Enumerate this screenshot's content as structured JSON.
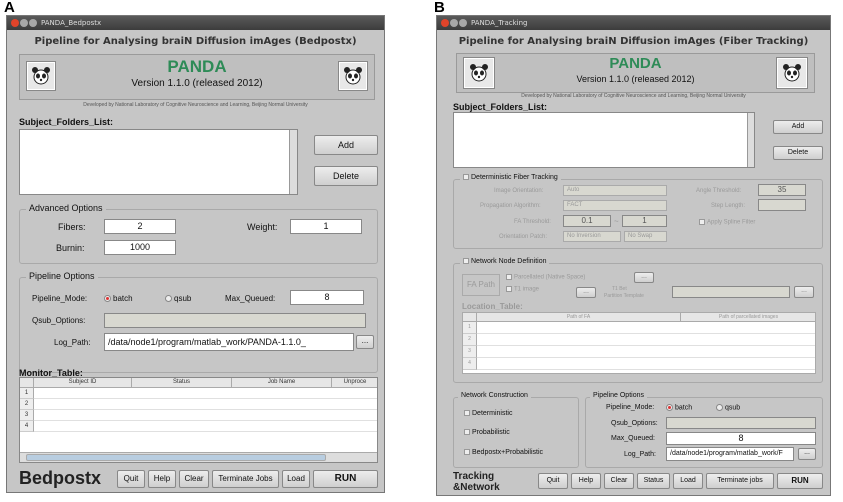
{
  "panels": {
    "a": "A",
    "b": "B"
  },
  "bedpostx": {
    "window_title": "PANDA_Bedpostx",
    "header": "Pipeline for Analysing braiN Diffusion imAges (Bedpostx)",
    "panda_name": "PANDA",
    "version": "Version 1.1.0 (released 2012)",
    "developed_by": "Developed by National Laboratory of Cognitive Neuroscience and Learning, Beijing Normal University",
    "subject_folders_label": "Subject_Folders_List:",
    "add_label": "Add",
    "delete_label": "Delete",
    "advanced_options": {
      "title": "Advanced Options",
      "fibers_label": "Fibers:",
      "fibers_value": "2",
      "weight_label": "Weight:",
      "weight_value": "1",
      "burnin_label": "Burnin:",
      "burnin_value": "1000"
    },
    "pipeline_options": {
      "title": "Pipeline Options",
      "mode_label": "Pipeline_Mode:",
      "batch_label": "batch",
      "qsub_label": "qsub",
      "max_queued_label": "Max_Queued:",
      "max_queued_value": "8",
      "qsub_options_label": "Qsub_Options:",
      "qsub_options_value": "",
      "log_path_label": "Log_Path:",
      "log_path_value": "/data/node1/program/matlab_work/PANDA-1.1.0_",
      "browse_label": "..."
    },
    "monitor_table": {
      "label": "Monitor_Table:",
      "columns": [
        "Subject ID",
        "Status",
        "Job Name",
        "Unproce"
      ],
      "rows": [
        "1",
        "2",
        "3",
        "4"
      ]
    },
    "footer_title": "Bedpostx",
    "buttons": {
      "quit": "Quit",
      "help": "Help",
      "clear": "Clear",
      "terminate": "Terminate Jobs",
      "load": "Load",
      "run": "RUN"
    }
  },
  "tracking": {
    "window_title": "PANDA_Tracking",
    "header": "Pipeline for Analysing braiN Diffusion imAges (Fiber Tracking)",
    "panda_name": "PANDA",
    "version": "Version 1.1.0 (released 2012)",
    "developed_by": "Developed by National Laboratory of Cognitive Neuroscience and Learning, Beijing Normal University",
    "subject_folders_label": "Subject_Folders_List:",
    "add_label": "Add",
    "delete_label": "Delete",
    "deterministic": {
      "title": "Deterministic Fiber Tracking",
      "image_orientation_label": "Image Orientation:",
      "image_orientation_value": "Auto",
      "angle_threshold_label": "Angle Threshold:",
      "angle_threshold_value": "35",
      "propagation_label": "Propagation Algorithm:",
      "propagation_value": "FACT",
      "step_length_label": "Step Length:",
      "fa_threshold_label": "FA Threshold:",
      "fa_min": "0.1",
      "fa_tilde": "~",
      "fa_max": "1",
      "apply_spline_label": "Apply Spline Filter",
      "orientation_patch_label": "Orientation Patch:",
      "inversion_value": "No Inversion",
      "swap_value": "No Swap"
    },
    "network_node": {
      "title": "Network Node Definition",
      "fa_path_label": "FA Path",
      "parcellated_label": "Parcellated (Native Space)",
      "t1_image_label": "T1 image",
      "t1_bet_label": "T1 Bet",
      "partition_label": "Partition Template",
      "browse": "...",
      "location_table_label": "Location_Table:",
      "columns": [
        "Path of FA",
        "Path of parcellated images"
      ],
      "rows": [
        "1",
        "2",
        "3",
        "4"
      ]
    },
    "network_construction": {
      "title": "Network Construction",
      "deterministic_label": "Deterministic",
      "probabilistic_label": "Probabilistic",
      "bedpostx_label": "Bedpostx+Probabilistic"
    },
    "pipeline_options": {
      "title": "Pipeline Options",
      "mode_label": "Pipeline_Mode:",
      "batch_label": "batch",
      "qsub_label": "qsub",
      "qsub_options_label": "Qsub_Options:",
      "max_queued_label": "Max_Queued:",
      "max_queued_value": "8",
      "log_path_label": "Log_Path:",
      "log_path_value": "/data/node1/program/matlab_work/F",
      "browse_label": "..."
    },
    "footer_title": "Tracking &Network",
    "buttons": {
      "quit": "Quit",
      "help": "Help",
      "clear": "Clear",
      "status": "Status",
      "load": "Load",
      "terminate": "Terminate jobs",
      "run": "RUN"
    }
  },
  "colors": {
    "window_bg": "#c6c6c6",
    "panda_green": "#2e8b57",
    "titlebar": "#3c3c3c",
    "close_dot": "#e0442a"
  },
  "icons": [
    "panda-logo-icon",
    "close-dot-icon",
    "minimize-dot-icon",
    "maximize-dot-icon"
  ]
}
